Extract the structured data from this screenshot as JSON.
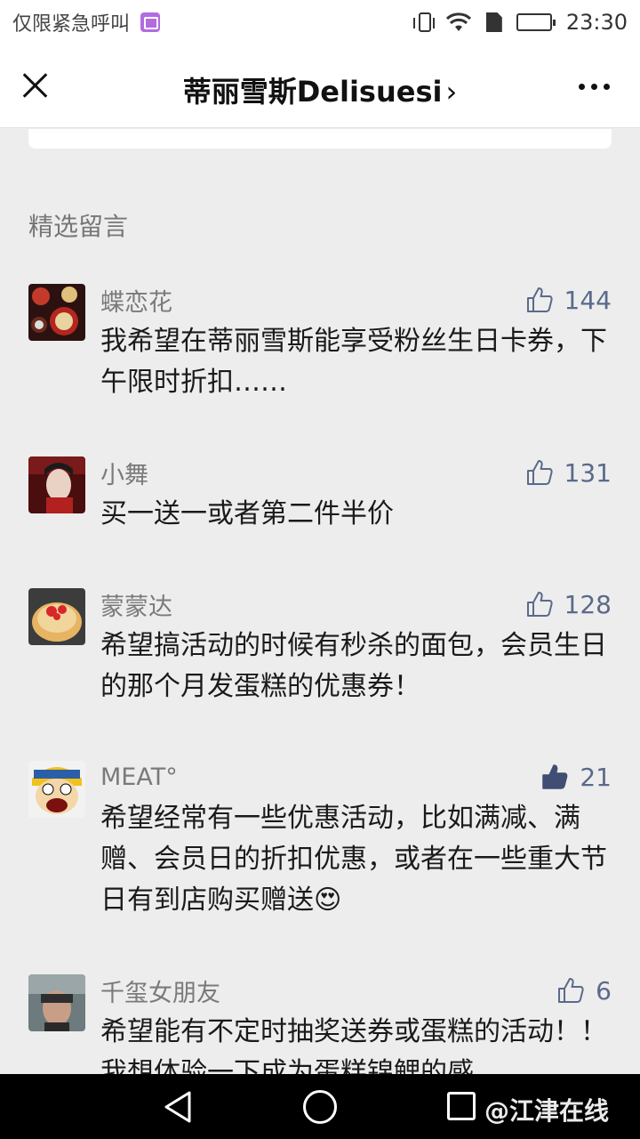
{
  "status_bar": {
    "carrier_text": "仅限紧急呼叫",
    "time": "23:30",
    "icons": [
      "gallery-icon",
      "vibrate-icon",
      "wifi-icon",
      "sim-icon",
      "battery-icon"
    ]
  },
  "nav": {
    "title": "蒂丽雪斯Delisuesi",
    "title_chevron": "›",
    "close_icon": "close-icon",
    "more_icon": "more-icon"
  },
  "section": {
    "title": "精选留言"
  },
  "comments": [
    {
      "name": "蝶恋花",
      "likes": "144",
      "liked": false,
      "text": "我希望在蒂丽雪斯能享受粉丝生日卡券，下午限时折扣……",
      "avatar": "cake-avatar"
    },
    {
      "name": "小舞",
      "likes": "131",
      "liked": false,
      "text": "买一送一或者第二件半价",
      "avatar": "portrait-avatar"
    },
    {
      "name": "蒙蒙达",
      "likes": "128",
      "liked": false,
      "text": "希望搞活动的时候有秒杀的面包，会员生日的那个月发蛋糕的优惠券！",
      "avatar": "pancake-avatar"
    },
    {
      "name": "MEAT°",
      "likes": "21",
      "liked": true,
      "text": "希望经常有一些优惠活动，比如满减、满赠、会员日的折扣优惠，或者在一些重大节日有到店购买赠送",
      "emoji": "😍",
      "avatar": "cartoon-avatar"
    },
    {
      "name": "千玺女朋友",
      "likes": "6",
      "liked": false,
      "text": "希望能有不定时抽奖送券或蛋糕的活动！！我想体验一下成为蛋糕锦鲤的感",
      "avatar": "photo-avatar"
    }
  ],
  "system_nav": {
    "watermark": "@江津在线",
    "icons": [
      "back-icon",
      "home-icon",
      "recents-icon"
    ]
  },
  "colors": {
    "page_bg": "#ededed",
    "like_color": "#5a6a8a",
    "name_color": "#7a7a7a"
  }
}
